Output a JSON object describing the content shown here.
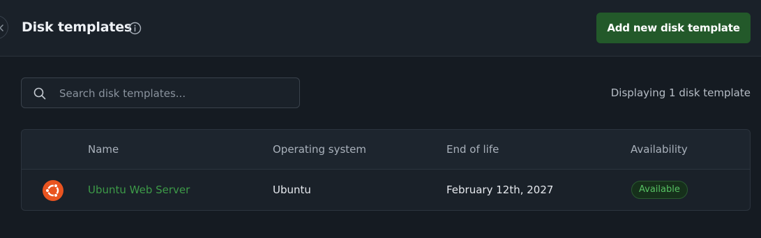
{
  "header": {
    "title": "Disk templates",
    "add_button_label": "Add new disk template"
  },
  "search": {
    "placeholder": "Search disk templates...",
    "value": ""
  },
  "summary": "Displaying 1 disk template",
  "table": {
    "columns": [
      "Name",
      "Operating system",
      "End of life",
      "Availability"
    ],
    "rows": [
      {
        "icon": "ubuntu-logo-icon",
        "name": "Ubuntu Web Server",
        "os": "Ubuntu",
        "end_of_life": "February 12th, 2027",
        "availability": "Available"
      }
    ]
  },
  "colors": {
    "background": "#151b22",
    "accent_button": "#23592a",
    "link_green": "#3d9a48",
    "badge_text": "#57c163",
    "ubuntu_orange": "#e95420"
  }
}
